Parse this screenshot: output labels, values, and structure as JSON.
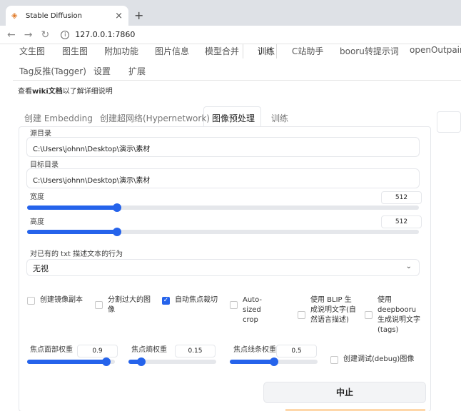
{
  "browser": {
    "tab_title": "Stable Diffusion",
    "url": "127.0.0.1:7860",
    "icons": {
      "favicon": "sd-icon",
      "close": "close-icon",
      "new_tab": "plus-icon",
      "back": "back-arrow-icon",
      "forward": "forward-arrow-icon",
      "reload": "reload-icon",
      "info": "info-icon"
    }
  },
  "main_tabs": [
    "文生图",
    "图生图",
    "附加功能",
    "图片信息",
    "模型合并",
    "训练",
    "C站助手",
    "booru转提示词",
    "openOutpaint",
    "Tag反推(Tagger)",
    "设置",
    "扩展"
  ],
  "active_main_tab": "训练",
  "info_text": {
    "prefix": "查看",
    "link": "wiki文档",
    "suffix": "以了解详细说明"
  },
  "sub_tabs": [
    "创建 Embedding",
    "创建超网络(Hypernetwork)",
    "图像预处理",
    "训练"
  ],
  "active_sub_tab": "图像预处理",
  "source_dir": {
    "label": "源目录",
    "value": "C:\\Users\\johnn\\Desktop\\演示\\素材"
  },
  "target_dir": {
    "label": "目标目录",
    "value": "C:\\Users\\johnn\\Desktop\\演示\\素材"
  },
  "width": {
    "label": "宽度",
    "value": "512",
    "fraction": 0.23
  },
  "height": {
    "label": "高度",
    "value": "512",
    "fraction": 0.23
  },
  "existing_txt": {
    "label": "对已有的 txt 描述文本的行为",
    "value": "无视"
  },
  "checkboxes": [
    {
      "label": "创建镜像副本",
      "checked": false
    },
    {
      "label": "分割过大的图像",
      "checked": false
    },
    {
      "label": "自动焦点裁切",
      "checked": true
    },
    {
      "label": "Auto-sized crop",
      "checked": false
    },
    {
      "label": "使用 BLIP 生成说明文字(自然语言描述)",
      "checked": false
    },
    {
      "label": "使用 deepbooru 生成说明文字(tags)",
      "checked": false
    }
  ],
  "focal_face": {
    "label": "焦点面部权重",
    "value": "0.9",
    "fraction": 0.9
  },
  "focal_entropy": {
    "label": "焦点熵权重",
    "value": "0.15",
    "fraction": 0.15
  },
  "focal_edges": {
    "label": "焦点线条权重",
    "value": "0.5",
    "fraction": 0.5
  },
  "debug_checkbox": {
    "label": "创建调试(debug)图像",
    "checked": false
  },
  "stop_button": "中止"
}
